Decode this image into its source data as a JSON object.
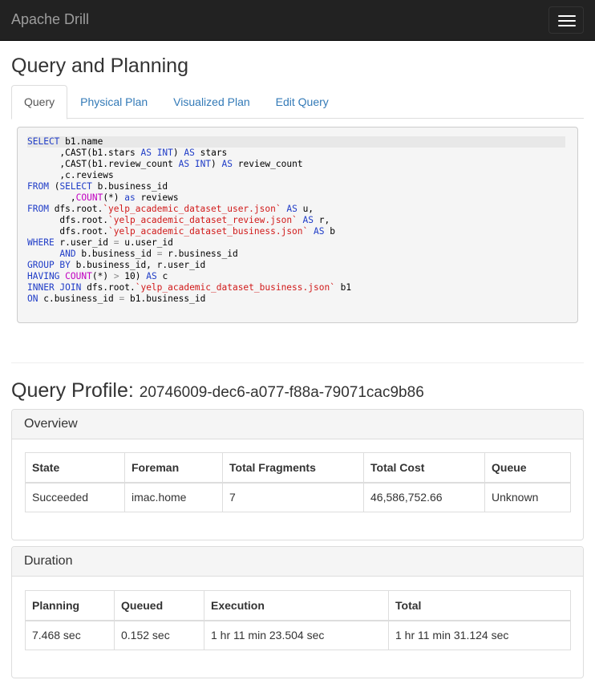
{
  "navbar": {
    "brand": "Apache Drill",
    "menu_icon": "hamburger-menu-icon"
  },
  "page": {
    "title": "Query and Planning"
  },
  "tabs": [
    {
      "label": "Query",
      "active": true
    },
    {
      "label": "Physical Plan",
      "active": false
    },
    {
      "label": "Visualized Plan",
      "active": false
    },
    {
      "label": "Edit Query",
      "active": false
    }
  ],
  "query_lines": [
    [
      {
        "t": "SELECT",
        "c": "kw"
      },
      {
        "t": " b1.name"
      }
    ],
    [
      {
        "t": "      ,CAST(b1.stars "
      },
      {
        "t": "AS",
        "c": "kw"
      },
      {
        "t": " "
      },
      {
        "t": "INT",
        "c": "kw"
      },
      {
        "t": ") "
      },
      {
        "t": "AS",
        "c": "kw"
      },
      {
        "t": " stars"
      }
    ],
    [
      {
        "t": "      ,CAST(b1.review_count "
      },
      {
        "t": "AS",
        "c": "kw"
      },
      {
        "t": " "
      },
      {
        "t": "INT",
        "c": "kw"
      },
      {
        "t": ") "
      },
      {
        "t": "AS",
        "c": "kw"
      },
      {
        "t": " review_count"
      }
    ],
    [
      {
        "t": "      ,c.reviews"
      }
    ],
    [
      {
        "t": "FROM",
        "c": "kw"
      },
      {
        "t": " ("
      },
      {
        "t": "SELECT",
        "c": "kw"
      },
      {
        "t": " b.business_id"
      }
    ],
    [
      {
        "t": "        ,"
      },
      {
        "t": "COUNT",
        "c": "fn"
      },
      {
        "t": "(*) "
      },
      {
        "t": "as",
        "c": "kw"
      },
      {
        "t": " reviews"
      }
    ],
    [
      {
        "t": "FROM",
        "c": "kw"
      },
      {
        "t": " dfs.root."
      },
      {
        "t": "`yelp_academic_dataset_user.json`",
        "c": "str"
      },
      {
        "t": " "
      },
      {
        "t": "AS",
        "c": "kw"
      },
      {
        "t": " u,"
      }
    ],
    [
      {
        "t": "      dfs.root."
      },
      {
        "t": "`yelp_academic_dataset_review.json`",
        "c": "str"
      },
      {
        "t": " "
      },
      {
        "t": "AS",
        "c": "kw"
      },
      {
        "t": " r,"
      }
    ],
    [
      {
        "t": "      dfs.root."
      },
      {
        "t": "`yelp_academic_dataset_business.json`",
        "c": "str"
      },
      {
        "t": " "
      },
      {
        "t": "AS",
        "c": "kw"
      },
      {
        "t": " b"
      }
    ],
    [
      {
        "t": "WHERE",
        "c": "kw"
      },
      {
        "t": " r.user_id "
      },
      {
        "t": "=",
        "c": "op"
      },
      {
        "t": " u.user_id"
      }
    ],
    [
      {
        "t": "      "
      },
      {
        "t": "AND",
        "c": "kw"
      },
      {
        "t": " b.business_id "
      },
      {
        "t": "=",
        "c": "op"
      },
      {
        "t": " r.business_id"
      }
    ],
    [
      {
        "t": "GROUP BY",
        "c": "kw"
      },
      {
        "t": " b.business_id, r.user_id"
      }
    ],
    [
      {
        "t": "HAVING",
        "c": "kw"
      },
      {
        "t": " "
      },
      {
        "t": "COUNT",
        "c": "fn"
      },
      {
        "t": "(*) "
      },
      {
        "t": ">",
        "c": "op"
      },
      {
        "t": " 10) "
      },
      {
        "t": "AS",
        "c": "kw"
      },
      {
        "t": " c"
      }
    ],
    [
      {
        "t": "INNER JOIN",
        "c": "kw"
      },
      {
        "t": " dfs.root."
      },
      {
        "t": "`yelp_academic_dataset_business.json`",
        "c": "str"
      },
      {
        "t": " b1"
      }
    ],
    [
      {
        "t": "ON",
        "c": "kw"
      },
      {
        "t": " c.business_id "
      },
      {
        "t": "=",
        "c": "op"
      },
      {
        "t": " b1.business_id"
      }
    ]
  ],
  "profile": {
    "label": "Query Profile:",
    "id": "20746009-dec6-a077-f88a-79071cac9b86"
  },
  "overview": {
    "heading": "Overview",
    "headers": [
      "State",
      "Foreman",
      "Total Fragments",
      "Total Cost",
      "Queue"
    ],
    "row": [
      "Succeeded",
      "imac.home",
      "7",
      "46,586,752.66",
      "Unknown"
    ]
  },
  "duration": {
    "heading": "Duration",
    "headers": [
      "Planning",
      "Queued",
      "Execution",
      "Total"
    ],
    "row": [
      "7.468 sec",
      "0.152 sec",
      "1 hr 11 min 23.504 sec",
      "1 hr 11 min 31.124 sec"
    ]
  },
  "colors": {
    "navbar_bg": "#222222",
    "link": "#337ab7",
    "keyword": "#1f3cc7",
    "function": "#c000c0",
    "string": "#d11a1a"
  }
}
